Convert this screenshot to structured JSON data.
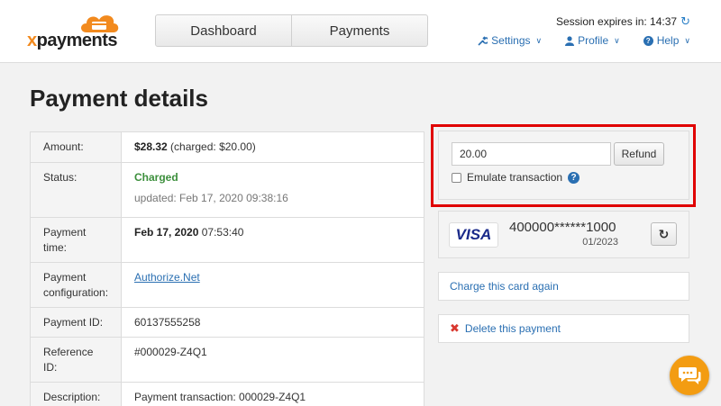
{
  "header": {
    "logo_text": "xpayments",
    "nav_tabs": [
      {
        "label": "Dashboard"
      },
      {
        "label": "Payments"
      }
    ],
    "session_text": "Session expires in: 14:37",
    "menu": [
      {
        "label": "Settings",
        "icon": "wrench-icon"
      },
      {
        "label": "Profile",
        "icon": "user-icon"
      },
      {
        "label": "Help",
        "icon": "question-circle-icon"
      }
    ]
  },
  "page_title": "Payment details",
  "details": [
    {
      "label": "Amount:",
      "value_bold": "$28.32",
      "value_rest": " (charged: $20.00)"
    },
    {
      "label": "Status:",
      "status": "Charged",
      "updated": "updated: Feb 17, 2020 09:38:16"
    },
    {
      "label": "Payment time:",
      "value_bold": "Feb 17, 2020",
      "value_rest": " 07:53:40"
    },
    {
      "label": "Payment configuration:",
      "link": "Authorize.Net"
    },
    {
      "label": "Payment ID:",
      "value": "60137555258"
    },
    {
      "label": "Reference ID:",
      "value": "#000029-Z4Q1"
    },
    {
      "label": "Description:",
      "value": "Payment transaction: 000029-Z4Q1"
    }
  ],
  "refund": {
    "amount_value": "20.00",
    "button_label": "Refund",
    "emulate_label": "Emulate transaction",
    "emulate_checked": false
  },
  "card": {
    "brand": "VISA",
    "number": "400000******1000",
    "expiry": "01/2023"
  },
  "actions": {
    "charge_label": "Charge this card again",
    "delete_label": "Delete this payment"
  },
  "colors": {
    "accent": "#2a6fb2",
    "highlight": "#e00000",
    "charged": "#3c8f3c",
    "chat": "#f39c12"
  }
}
